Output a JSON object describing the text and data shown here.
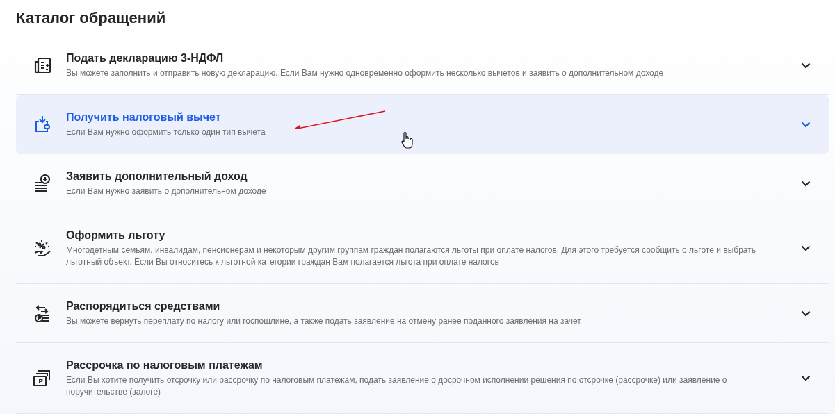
{
  "title": "Каталог обращений",
  "items": [
    {
      "kind": "declaration",
      "title": "Подать декларацию 3-НДФЛ",
      "description": "Вы можете заполнить и отправить новую декларацию. Если Вам нужно одновременно оформить несколько вычетов и заявить о дополнительном доходе",
      "selected": false
    },
    {
      "kind": "deduction",
      "title": "Получить налоговый вычет",
      "description": "Если Вам нужно оформить только один тип вычета",
      "selected": true
    },
    {
      "kind": "income",
      "title": "Заявить дополнительный доход",
      "description": "Если Вам нужно заявить о дополнительном доходе",
      "selected": false
    },
    {
      "kind": "benefit",
      "title": "Оформить льготу",
      "description": "Многодетным семьям, инвалидам, пенсионерам и некоторым другим группам граждан полагаются льготы при оплате налогов. Для этого требуется сообщить о льготе и выбрать льготный объект. Если Вы относитесь к льготной категории граждан Вам полагается льгота при оплате налогов",
      "selected": false
    },
    {
      "kind": "funds",
      "title": "Распорядиться средствами",
      "description": "Вы можете вернуть переплату по налогу или госпошлине, а также подать заявление на отмену ранее поданного заявления на зачет",
      "selected": false
    },
    {
      "kind": "installment",
      "title": "Рассрочка по налоговым платежам",
      "description": "Если Вы хотите получить отсрочку или рассрочку по налоговым платежам, подать заявление о досрочном исполнении решения по отсрочке (рассрочке) или заявление о поручительстве (залоге)",
      "selected": false
    }
  ]
}
